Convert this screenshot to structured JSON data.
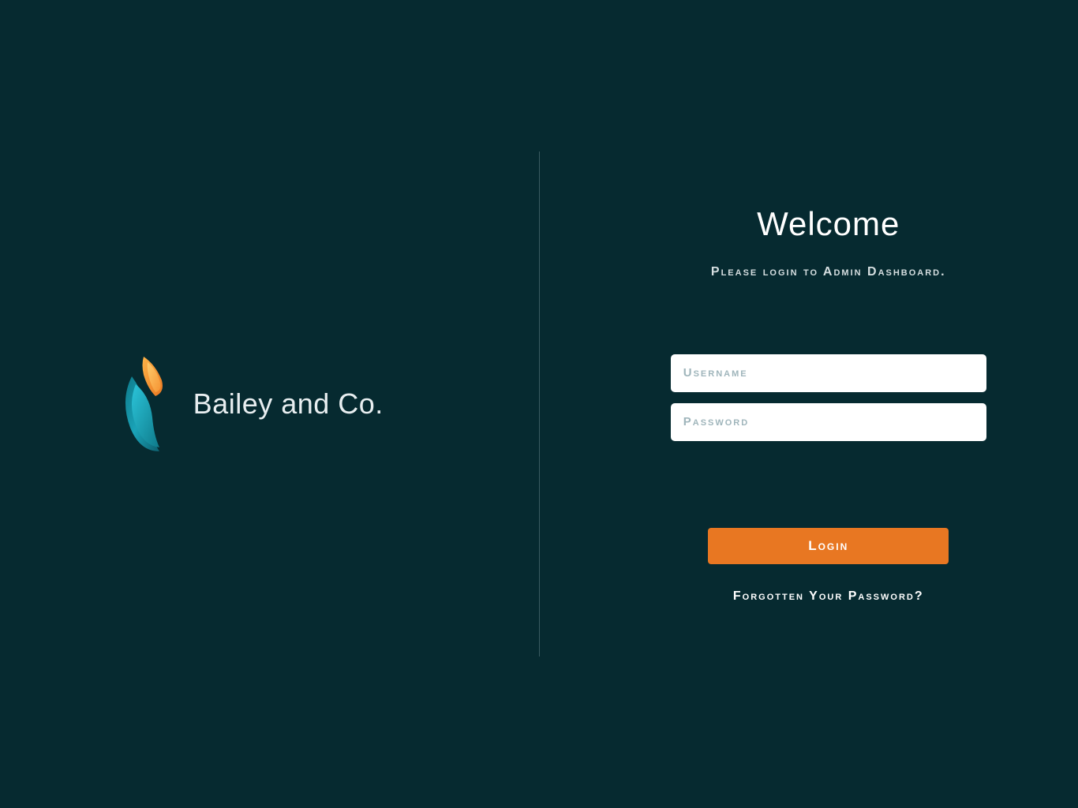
{
  "brand": {
    "name": "Bailey and Co."
  },
  "login": {
    "title": "Welcome",
    "subtitle": "Please login to Admin Dashboard.",
    "username_placeholder": "Username",
    "password_placeholder": "Password",
    "button_label": "Login",
    "forgot_label": "Forgotten Your Password?"
  },
  "colors": {
    "background": "#062a30",
    "accent": "#e87722",
    "text_light": "#ffffff"
  }
}
